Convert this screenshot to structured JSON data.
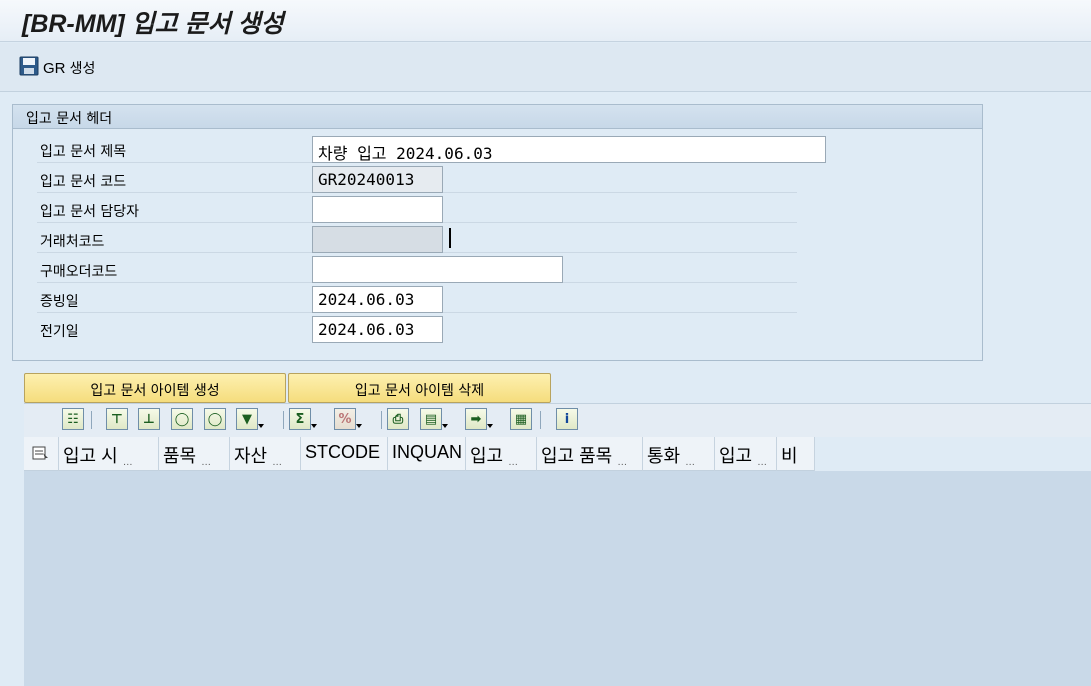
{
  "window": {
    "title": "[BR-MM] 입고 문서 생성"
  },
  "toolbar": {
    "gr_button_prefix": "GR",
    "gr_button_suffix": "생성",
    "save_icon": "save-icon"
  },
  "header_panel": {
    "title": "입고 문서 헤더",
    "fields": [
      {
        "label": "입고 문서 제목",
        "value": "차량 입고 2024.06.03"
      },
      {
        "label": "입고 문서 코드",
        "value": "GR20240013"
      },
      {
        "label": "입고 문서 담당자",
        "value": ""
      },
      {
        "label": "거래처코드",
        "value": ""
      },
      {
        "label": "구매오더코드",
        "value": ""
      },
      {
        "label": "증빙일",
        "value": "2024.06.03"
      },
      {
        "label": "전기일",
        "value": "2024.06.03"
      }
    ]
  },
  "buttons": {
    "create_item": "입고 문서 아이템 생성",
    "delete_item": "입고 문서 아이템 삭제"
  },
  "alv_toolbar": {
    "icons": [
      "details-icon",
      "align-top-icon",
      "align-bottom-icon",
      "find-icon",
      "find-next-icon",
      "filter-icon",
      "sum-icon",
      "subtotal-icon",
      "print-icon",
      "views-icon",
      "export-icon",
      "layout-icon",
      "info-icon"
    ]
  },
  "grid": {
    "columns": [
      {
        "text": "입고 시",
        "ellipsis": "…"
      },
      {
        "text": "품목",
        "ellipsis": "…"
      },
      {
        "text": "자산",
        "ellipsis": "…"
      },
      {
        "text": "STCODE",
        "ellipsis": ""
      },
      {
        "text": "INQUAN",
        "ellipsis": ""
      },
      {
        "text": "입고",
        "ellipsis": "…"
      },
      {
        "text": "입고 품목",
        "ellipsis": "…"
      },
      {
        "text": "통화",
        "ellipsis": "…"
      },
      {
        "text": "입고",
        "ellipsis": "…"
      },
      {
        "text": "비",
        "ellipsis": ""
      }
    ]
  }
}
